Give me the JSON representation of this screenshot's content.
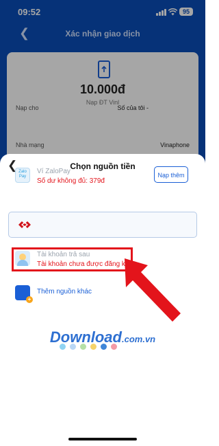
{
  "status_bar": {
    "time": "09:52",
    "battery": "95"
  },
  "header": {
    "title": "Xác nhận giao dịch"
  },
  "transaction": {
    "amount": "10.000đ",
    "description": "Nạp ĐT Vinl",
    "rows": [
      {
        "label": "Nạp cho",
        "value": "Số của tôi -"
      },
      {
        "label": "Nhà mạng",
        "value": "Vinaphone"
      }
    ]
  },
  "sheet": {
    "title": "Chọn nguồn tiền",
    "zalopay": {
      "logo_text": "Zalo Pay",
      "name": "Ví ZaloPay",
      "balance_note": "Số dư không đủ: 379đ",
      "topup_label": "Nạp thêm"
    },
    "paylater": {
      "name": "Tài khoản trả sau",
      "status": "Tài khoản chưa được đăng ký"
    },
    "add_source": {
      "label": "Thêm nguồn khác"
    }
  },
  "watermark": {
    "main": "Download",
    "suffix": ".com.vn"
  },
  "colors": {
    "primary": "#1a5fd6",
    "header_bg": "#0a4db8",
    "error": "#e3141b",
    "highlight": "#e3141b",
    "dots": [
      "#8fd3f2",
      "#b9d7f5",
      "#b6e0a6",
      "#f6d36a",
      "#3f86d8",
      "#f39aa6"
    ]
  },
  "icons": [
    "back-icon",
    "phone-icon",
    "signal-icon",
    "wifi-icon",
    "battery-icon",
    "zalopay-logo-icon",
    "bank-logo-icon",
    "paylater-avatar-icon",
    "add-wallet-icon",
    "red-arrow-icon"
  ]
}
